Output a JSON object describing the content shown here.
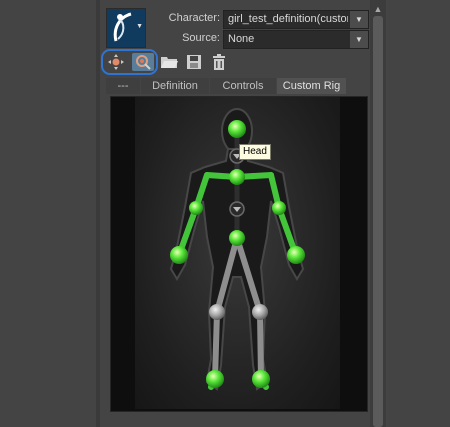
{
  "character": {
    "label": "Character:",
    "value": "girl_test_definition(custom"
  },
  "source": {
    "label": "Source:",
    "value": "None"
  },
  "toolbar": {
    "buttons": [
      {
        "name": "full-body-select",
        "icon": "body-select-icon",
        "active": false
      },
      {
        "name": "effector-select",
        "icon": "effector-select-icon",
        "active": true
      },
      {
        "name": "open",
        "icon": "folder-icon",
        "active": false
      },
      {
        "name": "save",
        "icon": "save-icon",
        "active": false
      },
      {
        "name": "delete",
        "icon": "trash-icon",
        "active": false
      }
    ]
  },
  "tabs": [
    {
      "label": "---"
    },
    {
      "label": "Definition"
    },
    {
      "label": "Controls"
    },
    {
      "label": "Custom Rig",
      "active": true
    }
  ],
  "viewport": {
    "tooltip": "Head"
  },
  "colors": {
    "accent": "#2f74d0",
    "effector_green": "#56e83a",
    "bone_green": "#43c43a",
    "inactive_gray": "#9a9a9a"
  }
}
